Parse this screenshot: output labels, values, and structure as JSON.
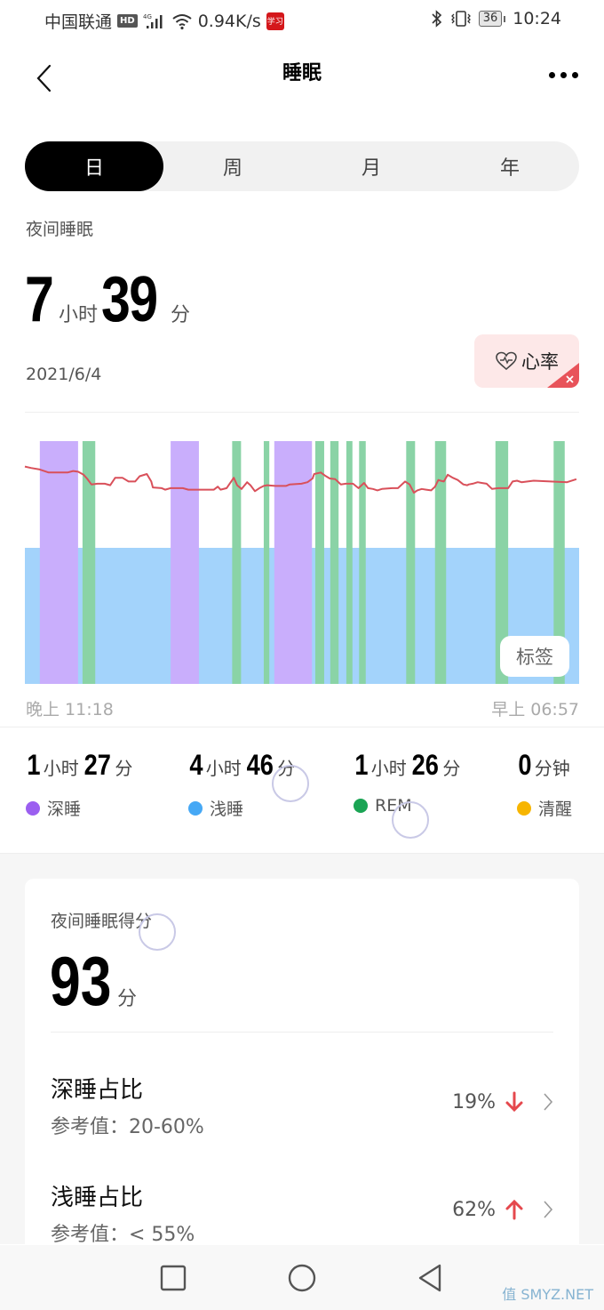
{
  "status_bar": {
    "carrier": "中国联通",
    "hd_badge": "HD",
    "network": "4G",
    "speed": "0.94K/s",
    "app_badge": "学习",
    "battery": "36",
    "time": "10:24"
  },
  "header": {
    "title": "睡眠",
    "back_icon": "chevron-left-icon",
    "more_icon": "more-dots-icon"
  },
  "tabs": [
    {
      "label": "日",
      "active": true
    },
    {
      "label": "周",
      "active": false
    },
    {
      "label": "月",
      "active": false
    },
    {
      "label": "年",
      "active": false
    }
  ],
  "summary": {
    "section_label": "夜间睡眠",
    "hours": "7",
    "hours_unit": "小时",
    "minutes": "39",
    "minutes_unit": "分",
    "date": "2021/6/4",
    "heart_rate_chip": "心率"
  },
  "chart_data": {
    "type": "area",
    "title": "",
    "x_start_label": "晚上 11:18",
    "x_end_label": "早上 06:57",
    "stages": {
      "light_sleep_base": {
        "start": 0.0,
        "end": 1.0
      },
      "deep_sleep": [
        {
          "start": 0.027,
          "end": 0.096
        },
        {
          "start": 0.263,
          "end": 0.314
        },
        {
          "start": 0.45,
          "end": 0.518
        }
      ],
      "rem": [
        {
          "start": 0.104,
          "end": 0.127
        },
        {
          "start": 0.374,
          "end": 0.39
        },
        {
          "start": 0.431,
          "end": 0.441
        },
        {
          "start": 0.524,
          "end": 0.54
        },
        {
          "start": 0.551,
          "end": 0.566
        },
        {
          "start": 0.58,
          "end": 0.591
        },
        {
          "start": 0.603,
          "end": 0.615
        },
        {
          "start": 0.688,
          "end": 0.704
        },
        {
          "start": 0.74,
          "end": 0.76
        },
        {
          "start": 0.849,
          "end": 0.872
        },
        {
          "start": 0.954,
          "end": 0.974
        }
      ]
    },
    "heart_rate_series": {
      "name": "心率",
      "note": "relative heart-rate trace over the night (0=low,1=high)",
      "x": [
        0.0,
        0.011,
        0.027,
        0.043,
        0.077,
        0.087,
        0.096,
        0.106,
        0.112,
        0.12,
        0.131,
        0.144,
        0.154,
        0.163,
        0.176,
        0.187,
        0.199,
        0.207,
        0.22,
        0.228,
        0.231,
        0.247,
        0.253,
        0.263,
        0.285,
        0.295,
        0.341,
        0.348,
        0.353,
        0.364,
        0.377,
        0.383,
        0.391,
        0.401,
        0.407,
        0.415,
        0.423,
        0.431,
        0.437,
        0.452,
        0.471,
        0.478,
        0.499,
        0.51,
        0.519,
        0.522,
        0.534,
        0.541,
        0.55,
        0.56,
        0.57,
        0.579,
        0.592,
        0.602,
        0.612,
        0.619,
        0.628,
        0.636,
        0.644,
        0.663,
        0.673,
        0.686,
        0.694,
        0.702,
        0.708,
        0.716,
        0.724,
        0.733,
        0.74,
        0.746,
        0.75,
        0.756,
        0.763,
        0.772,
        0.781,
        0.791,
        0.798,
        0.801,
        0.808,
        0.817,
        0.824,
        0.833,
        0.843,
        0.854,
        0.872,
        0.88,
        0.888,
        0.896,
        0.918,
        0.978,
        0.995
      ],
      "y": [
        0.66,
        0.64,
        0.62,
        0.58,
        0.58,
        0.6,
        0.59,
        0.55,
        0.5,
        0.42,
        0.43,
        0.43,
        0.41,
        0.51,
        0.51,
        0.46,
        0.46,
        0.53,
        0.56,
        0.46,
        0.38,
        0.37,
        0.35,
        0.37,
        0.37,
        0.35,
        0.35,
        0.39,
        0.35,
        0.37,
        0.51,
        0.41,
        0.36,
        0.45,
        0.41,
        0.33,
        0.37,
        0.4,
        0.41,
        0.4,
        0.4,
        0.42,
        0.43,
        0.45,
        0.5,
        0.56,
        0.58,
        0.54,
        0.5,
        0.49,
        0.42,
        0.43,
        0.43,
        0.37,
        0.44,
        0.37,
        0.36,
        0.34,
        0.36,
        0.37,
        0.37,
        0.46,
        0.42,
        0.31,
        0.34,
        0.36,
        0.35,
        0.34,
        0.39,
        0.48,
        0.47,
        0.46,
        0.55,
        0.51,
        0.48,
        0.42,
        0.41,
        0.42,
        0.43,
        0.45,
        0.44,
        0.43,
        0.36,
        0.37,
        0.37,
        0.46,
        0.47,
        0.45,
        0.47,
        0.45,
        0.49,
        0.55,
        0.55,
        0.63,
        0.6,
        0.61,
        0.62,
        0.95
      ]
    },
    "legend": [
      {
        "name": "深睡",
        "color": "#9b5ff0"
      },
      {
        "name": "浅睡",
        "color": "#46a8f5"
      },
      {
        "name": "REM",
        "color": "#1aa454"
      },
      {
        "name": "清醒",
        "color": "#f7b500"
      }
    ],
    "colors": {
      "deep": "#c9aefc",
      "light": "#a3d3fb",
      "rem": "#8ad3a6",
      "heart_rate": "#d9505a"
    },
    "tag_button": "标签"
  },
  "stats": [
    {
      "h": "1",
      "h_unit": "小时",
      "m": "27",
      "m_unit": "分",
      "label": "深睡"
    },
    {
      "h": "4",
      "h_unit": "小时",
      "m": "46",
      "m_unit": "分",
      "label": "浅睡"
    },
    {
      "h": "1",
      "h_unit": "小时",
      "m": "26",
      "m_unit": "分",
      "label": "REM"
    },
    {
      "m": "0",
      "m_unit": "分钟",
      "label": "清醒"
    }
  ],
  "score": {
    "label": "夜间睡眠得分",
    "value": "93",
    "unit": "分"
  },
  "metrics": [
    {
      "title": "深睡占比",
      "reference": "参考值：20-60%",
      "value": "19%",
      "trend": "down"
    },
    {
      "title": "浅睡占比",
      "reference": "参考值：< 55%",
      "value": "62%",
      "trend": "up"
    }
  ],
  "watermark": "值 SMYZ.NET"
}
